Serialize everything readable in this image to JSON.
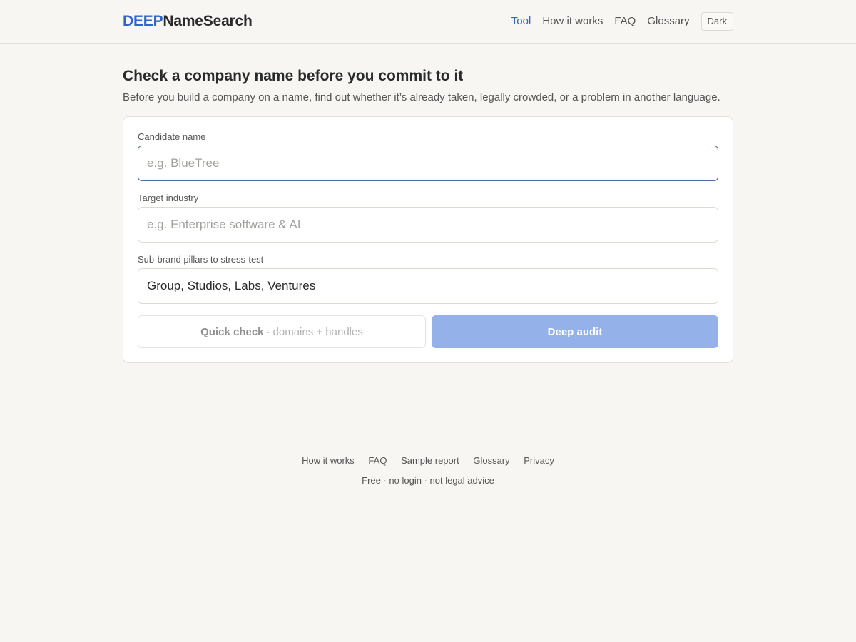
{
  "header": {
    "brand_part1": "DEEP",
    "brand_part2": "NameSearch",
    "nav": [
      {
        "label": "Tool",
        "active": true
      },
      {
        "label": "How it works",
        "active": false
      },
      {
        "label": "FAQ",
        "active": false
      },
      {
        "label": "Glossary",
        "active": false
      }
    ],
    "theme_toggle_label": "Dark"
  },
  "main": {
    "title": "Check a company name before you commit to it",
    "subtitle": "Before you build a company on a name, find out whether it’s already taken, legally crowded, or a problem in another language."
  },
  "form": {
    "candidate": {
      "label": "Candidate name",
      "placeholder": "e.g. BlueTree",
      "value": ""
    },
    "industry": {
      "label": "Target industry",
      "placeholder": "e.g. Enterprise software & AI",
      "value": ""
    },
    "pillars": {
      "label": "Sub-brand pillars to stress-test",
      "placeholder": "",
      "value": "Group, Studios, Labs, Ventures"
    },
    "quick_check": {
      "label": "Quick check",
      "separator": "·",
      "sublabel": "domains + handles"
    },
    "deep_audit_label": "Deep audit"
  },
  "footer": {
    "links": [
      "How it works",
      "FAQ",
      "Sample report",
      "Glossary",
      "Privacy"
    ],
    "note": "Free · no login · not legal advice"
  },
  "colors": {
    "accent": "#2f64c8",
    "background": "#f7f6f2",
    "deep_audit_button": "#95b1ea"
  }
}
